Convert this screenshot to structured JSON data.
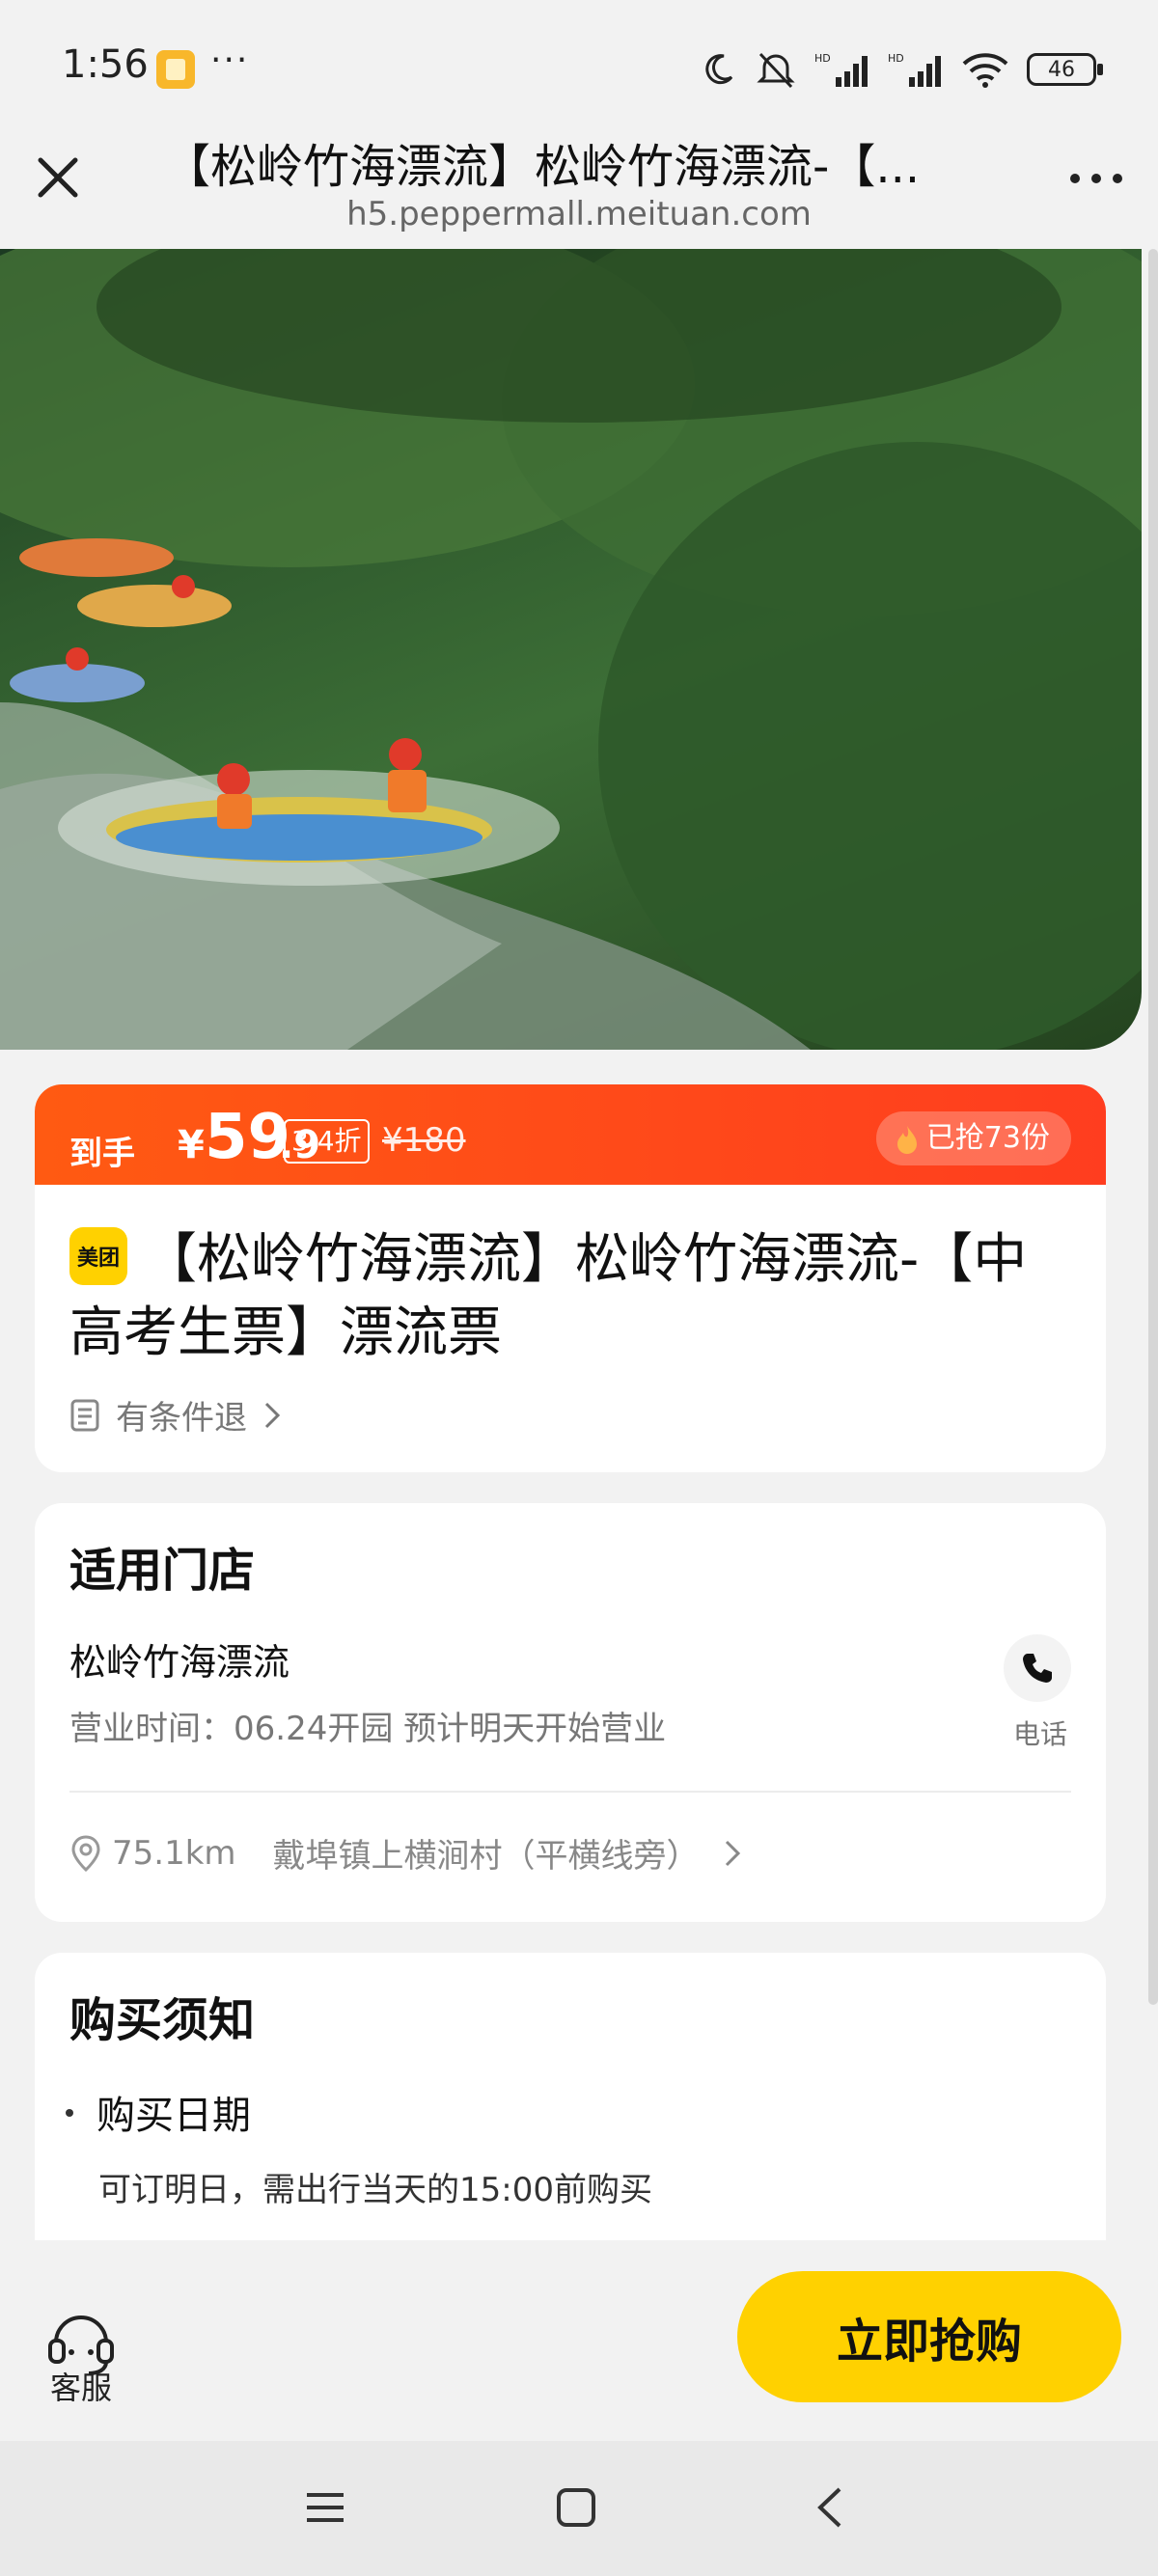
{
  "status_bar": {
    "time": "1:56",
    "dots": "···",
    "battery": "46"
  },
  "header": {
    "title": "【松岭竹海漂流】松岭竹海漂流-【...",
    "url": "h5.peppermall.meituan.com"
  },
  "price": {
    "prefix": "到手",
    "currency": "¥",
    "integer": "59",
    "decimal": ".9",
    "discount": "3.4折",
    "original": "¥180",
    "sold": "已抢73份"
  },
  "product": {
    "brand_tag": "美团",
    "title": "【松岭竹海漂流】松岭竹海漂流-【中高考生票】漂流票",
    "refund": "有条件退"
  },
  "store": {
    "section_title": "适用门店",
    "name": "松岭竹海漂流",
    "hours": "营业时间：06.24开园 预计明天开始营业",
    "phone_label": "电话",
    "distance": "75.1km",
    "address": "戴埠镇上横涧村（平横线旁）"
  },
  "notice": {
    "section_title": "购买须知",
    "item_title": "购买日期",
    "item_desc": "可订明日，需出行当天的15:00前购买"
  },
  "bottom": {
    "service_label": "客服",
    "buy_label": "立即抢购"
  },
  "colors": {
    "price_bar": "#ff4a16",
    "buy_button": "#ffd100",
    "brand_tag": "#ffd100"
  }
}
